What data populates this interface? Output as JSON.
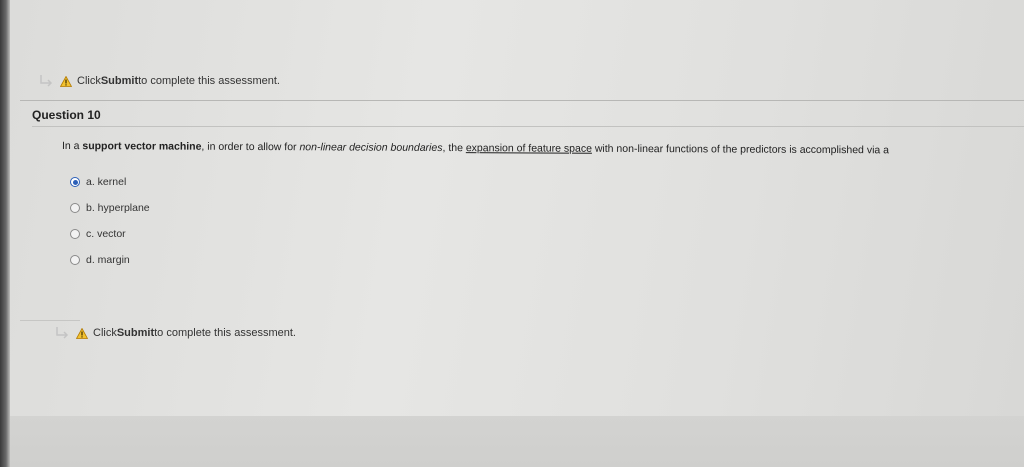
{
  "assessment": {
    "submit_notice_prefix": "Click ",
    "submit_notice_bold": "Submit",
    "submit_notice_suffix": " to complete this assessment."
  },
  "question": {
    "label": "Question 10",
    "text_part1": "In a ",
    "text_bold": "support vector machine",
    "text_part2": ", in order to allow for ",
    "text_italic": "non-linear decision boundaries",
    "text_part3": ", the ",
    "text_link": "expansion of feature space",
    "text_part4": " with non-linear functions of the predictors is accomplished via a",
    "options": [
      {
        "label": "a. kernel",
        "selected": true
      },
      {
        "label": "b. hyperplane",
        "selected": false
      },
      {
        "label": "c. vector",
        "selected": false
      },
      {
        "label": "d. margin",
        "selected": false
      }
    ]
  },
  "icons": {
    "arrow": "return-arrow-icon",
    "warning": "warning-icon"
  },
  "colors": {
    "radio_selected": "#2b5fb8",
    "warning_fill": "#f2c230"
  }
}
